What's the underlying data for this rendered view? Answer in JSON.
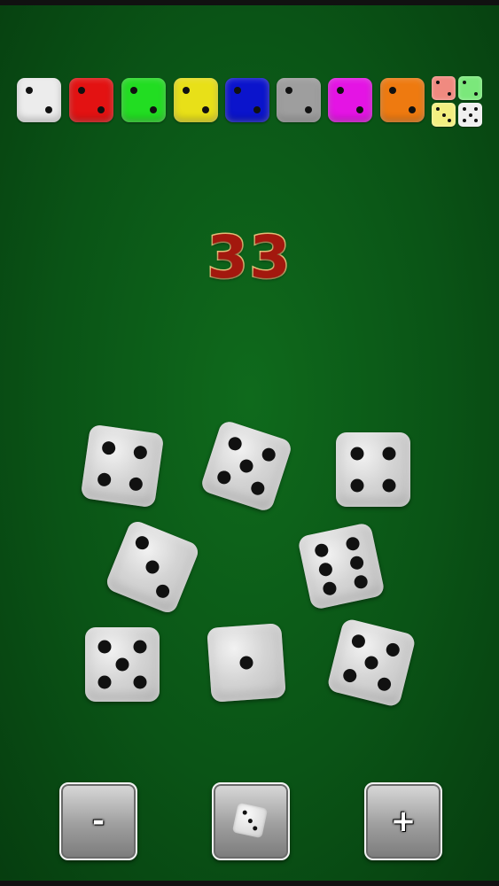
{
  "palette": {
    "colors": [
      {
        "name": "white",
        "hex": "#ececec"
      },
      {
        "name": "red",
        "hex": "#e31212"
      },
      {
        "name": "green",
        "hex": "#22dd22"
      },
      {
        "name": "yellow",
        "hex": "#e8e018"
      },
      {
        "name": "blue",
        "hex": "#0b14cc"
      },
      {
        "name": "gray",
        "hex": "#9e9e9e"
      },
      {
        "name": "magenta",
        "hex": "#e414e4"
      },
      {
        "name": "orange",
        "hex": "#ee7a10"
      }
    ],
    "mixed": [
      "#f08a80",
      "#7be87b",
      "#f2ef80",
      "#efefef"
    ],
    "mixed_label": "mixed-colors"
  },
  "total": "33",
  "dice": [
    1,
    2,
    3,
    4,
    5,
    6,
    7,
    8,
    9
  ],
  "dice_values": [
    4,
    5,
    4,
    3,
    6,
    5,
    1,
    5
  ],
  "controls": {
    "minus_label": "-",
    "plus_label": "+",
    "roll_icon": "die-icon"
  }
}
